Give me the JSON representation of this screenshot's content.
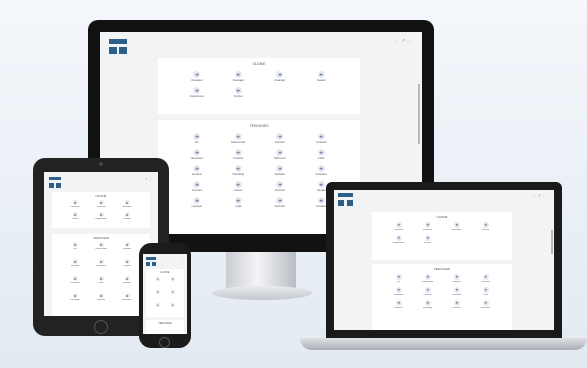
{
  "monitor": {
    "top_icons": "←  ↗  ⋮",
    "cards": [
      {
        "title": "ÜLDINE",
        "tiles": [
          "Ülevaated",
          "Kasutajad",
          "Aruanded",
          "Seaded",
          "Integratsioon",
          "Kinnitus"
        ]
      },
      {
        "title": "TEENUSED",
        "tiles": [
          "Kiri",
          "Dokumendid",
          "Kalender",
          "Kontaktid",
          "Ülesanded",
          "Projektid",
          "Tellimused",
          "Failid",
          "Arveldus",
          "Klienditugi",
          "Statistika",
          "Aruandlus",
          "Turundus",
          "Laoseis",
          "Personal",
          "Tarnijad",
          "Lepingud",
          "Logid",
          "Varundus",
          "Turvalisus"
        ]
      }
    ]
  },
  "laptop": {
    "top_icons": "← ↗ ⋮",
    "cards": [
      {
        "title": "ÜLDINE",
        "tiles": [
          "Ülevaated",
          "Kasutajad",
          "Aruanded",
          "Seaded",
          "Integratsioon",
          "Kinnitus"
        ]
      },
      {
        "title": "TEENUSED",
        "tiles": [
          "Kiri",
          "Dokumendid",
          "Kalender",
          "Kontaktid",
          "Ülesanded",
          "Projektid",
          "Tellimused",
          "Failid",
          "Arveldus",
          "Klienditugi",
          "Statistika",
          "Aruandlus"
        ]
      }
    ]
  },
  "tablet": {
    "top_icons": "← ↗ ⋮",
    "cards": [
      {
        "title": "ÜLDINE",
        "tiles": [
          "Ülevaated",
          "Kasutajad",
          "Aruanded",
          "Seaded",
          "Integratsioon",
          "Kinnitus"
        ]
      },
      {
        "title": "TEENUSED",
        "tiles": [
          "Kiri",
          "Dokumendid",
          "Kalender",
          "Kontaktid",
          "Ülesanded",
          "Projektid",
          "Tellimused",
          "Failid",
          "Arveldus",
          "Klienditugi",
          "Statistika",
          "Aruandlus"
        ]
      }
    ]
  },
  "phone": {
    "top_icons": "⋮",
    "cards": [
      {
        "title": "ÜLDINE",
        "tiles": [
          "Ülevaated",
          "Kasutajad",
          "Aruanded",
          "Seaded",
          "Integratsioon",
          "Kinnitus"
        ]
      },
      {
        "title": "TEENUSED",
        "tiles": []
      }
    ]
  },
  "colors": {
    "accent": "#2c5f8a",
    "screen_bg": "#f2f3f5",
    "icon_bg": "#e4e9f2"
  }
}
